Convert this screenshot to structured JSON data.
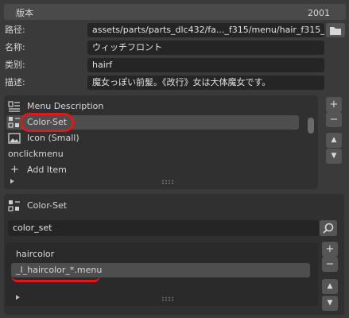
{
  "header": {
    "label": "版本",
    "value": "2001"
  },
  "properties": [
    {
      "label": "路径:",
      "value": "assets/parts/parts_dlc432/fa..._f315/menu/hair_f315_i_.txt"
    },
    {
      "label": "名称:",
      "value": "ウィッチフロント"
    },
    {
      "label": "类别:",
      "value": "hairf"
    },
    {
      "label": "描述:",
      "value": "魔女っぽい前髪。《改行》女は大体魔女です。"
    }
  ],
  "menu_list": {
    "items": [
      {
        "label": "Menu Description",
        "icon": "text-align-icon"
      },
      {
        "label": "Color-Set",
        "icon": "color-grid-icon",
        "selected": true
      },
      {
        "label": "Icon (Small)",
        "icon": "image-icon"
      }
    ],
    "onclick": "onclickmenu",
    "add_item": "Add Item"
  },
  "color_set": {
    "title": "Color-Set",
    "search_value": "color_set",
    "list_header": "haircolor",
    "items": [
      "_I_haircolor_*.menu"
    ]
  },
  "side_buttons": {
    "add": "+",
    "remove": "−",
    "up": "▲",
    "down": "▼"
  },
  "colors": {
    "annotation": "#e01818",
    "field_bg": "#252525",
    "panel_bg": "#303030"
  }
}
